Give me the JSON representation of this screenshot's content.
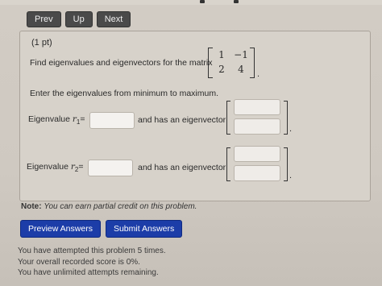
{
  "nav": {
    "prev_label": "Prev",
    "up_label": "Up",
    "next_label": "Next"
  },
  "problem": {
    "points": "(1 pt)",
    "question": "Find eigenvalues and eigenvectors for the matrix",
    "matrix": {
      "r1c1": "1",
      "r1c2": "−1",
      "r2c1": "2",
      "r2c2": "4"
    },
    "period": ".",
    "instruction": "Enter the eigenvalues from minimum to maximum.",
    "eigen1": {
      "label_prefix": "Eigenvalue ",
      "symbol": "r",
      "subscript": "1",
      "label_suffix": "=",
      "value": "",
      "vector_text": "and has an eigenvector",
      "vector": [
        "",
        ""
      ]
    },
    "eigen2": {
      "label_prefix": "Eigenvalue ",
      "symbol": "r",
      "subscript": "2",
      "label_suffix": "=",
      "value": "",
      "vector_text": "and has an eigenvector",
      "vector": [
        "",
        ""
      ]
    }
  },
  "note": {
    "bold": "Note:",
    "text": "You can earn partial credit on this problem."
  },
  "actions": {
    "preview_label": "Preview Answers",
    "submit_label": "Submit Answers"
  },
  "status": {
    "line1": "You have attempted this problem 5 times.",
    "line2": "Your overall recorded score is 0%.",
    "line3": "You have unlimited attempts remaining."
  },
  "colors": {
    "primary_button": "#1c3da8",
    "nav_button": "#4a4a4a"
  }
}
